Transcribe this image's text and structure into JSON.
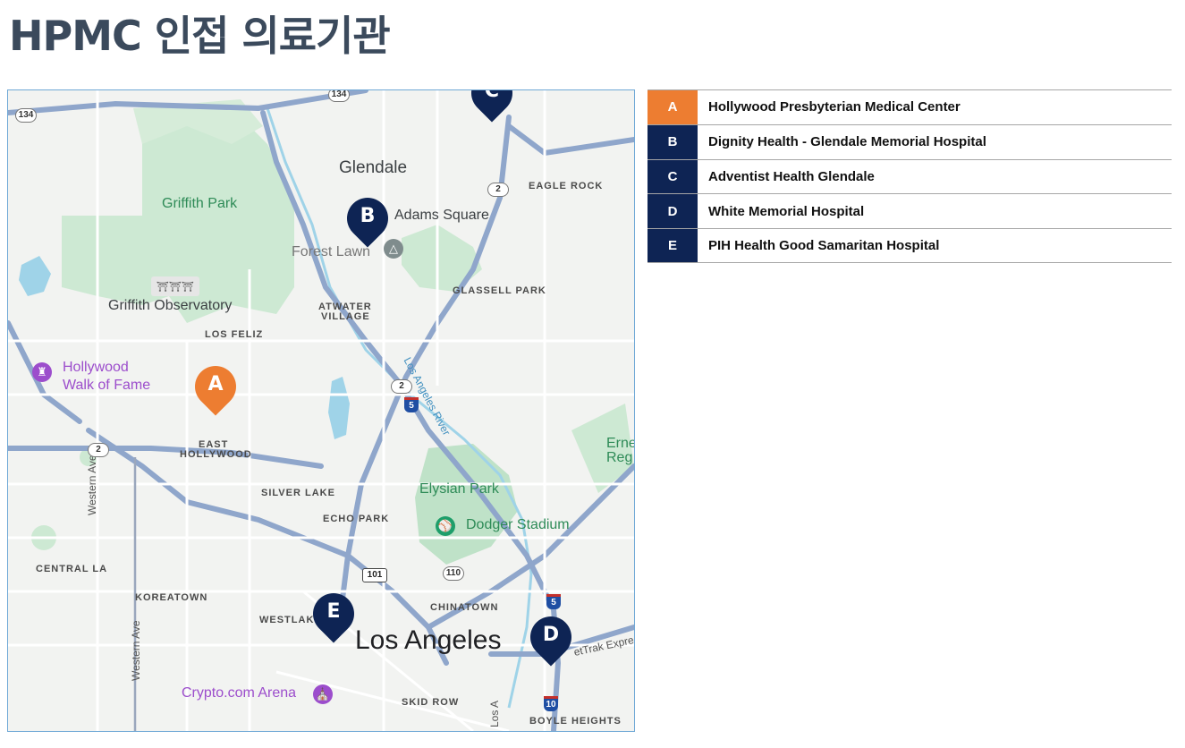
{
  "title": "HPMC 인접 의료기관",
  "colors": {
    "accent": "#ed7d31",
    "navy": "#0e2454",
    "title": "#3b4a5c"
  },
  "legend": [
    {
      "code": "A",
      "name": "Hollywood Presbyterian Medical Center",
      "color": "#ed7d31"
    },
    {
      "code": "B",
      "name": "Dignity Health - Glendale Memorial Hospital",
      "color": "#0e2454"
    },
    {
      "code": "C",
      "name": "Adventist Health Glendale",
      "color": "#0e2454"
    },
    {
      "code": "D",
      "name": "White Memorial Hospital",
      "color": "#0e2454"
    },
    {
      "code": "E",
      "name": "PIH Health Good Samaritan Hospital",
      "color": "#0e2454"
    }
  ],
  "map": {
    "labels": {
      "glendale": "Glendale",
      "los_angeles": "Los Angeles",
      "griffith_park": "Griffith Park",
      "griffith_observatory": "Griffith Observatory",
      "adams_square": "Adams Square",
      "forest_lawn": "Forest Lawn",
      "hollywood_walk_1": "Hollywood",
      "hollywood_walk_2": "Walk of Fame",
      "elysian_park": "Elysian Park",
      "dodger_stadium": "Dodger Stadium",
      "crypto_arena": "Crypto.com Arena",
      "eagle_rock": "EAGLE ROCK",
      "glassell_park": "GLASSELL PARK",
      "atwater_1": "ATWATER",
      "atwater_2": "VILLAGE",
      "los_feliz": "LOS FELIZ",
      "east_hollywood_1": "EAST",
      "east_hollywood_2": "HOLLYWOOD",
      "silver_lake": "SILVER LAKE",
      "echo_park": "ECHO PARK",
      "central_la": "CENTRAL LA",
      "koreatown": "KOREATOWN",
      "westlake": "WESTLAK",
      "chinatown": "CHINATOWN",
      "skid_row": "SKID ROW",
      "boyle_heights": "BOYLE HEIGHTS",
      "western_ave": "Western Ave",
      "los_angeles_river": "Los Angeles River",
      "ernest_1": "Erne",
      "ernest_2": "Reg",
      "metro_expr": "etTrak Expre",
      "los_river_bottom": "Los A"
    },
    "shields": {
      "ca134_a": "134",
      "ca134_b": "134",
      "ca2_a": "2",
      "ca2_b": "2",
      "ca2_c": "2",
      "us101": "101",
      "ca110": "110",
      "i5_a": "5",
      "i5_b": "5",
      "i10": "10"
    },
    "icons": {
      "forest_lawn": "cemetery-icon",
      "observatory": "observatory-icon",
      "walk_of_fame": "landmark-icon",
      "dodger": "stadium-icon",
      "arena": "arena-icon"
    }
  }
}
